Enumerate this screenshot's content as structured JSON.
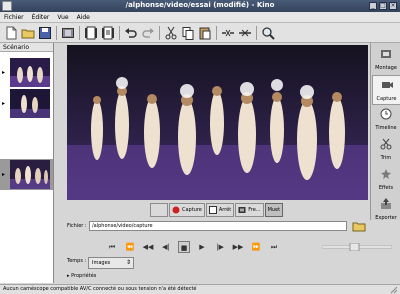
{
  "window": {
    "title": "/alphonse/video/essai (modifié) - Kino",
    "btn_min": "_",
    "btn_max": "□",
    "btn_close": "×"
  },
  "menu": [
    "Fichier",
    "Éditer",
    "Vue",
    "Aide"
  ],
  "scenario": {
    "header": "Scénario",
    "arrow": "▸"
  },
  "sidebar": [
    {
      "label": "Montage",
      "icon": "film-edit-icon"
    },
    {
      "label": "Capture",
      "icon": "camera-icon",
      "active": true
    },
    {
      "label": "Timeline",
      "icon": "clock-icon"
    },
    {
      "label": "Trim",
      "icon": "scissors-icon"
    },
    {
      "label": "Effets",
      "icon": "effects-icon"
    },
    {
      "label": "Exporter",
      "icon": "export-icon"
    }
  ],
  "capture": {
    "btn_capture": "Capture",
    "btn_stop": "Arrêt",
    "btn_frame": "Fre...",
    "btn_mute": "Muet"
  },
  "file": {
    "label": "Fichier :",
    "value": "/alphonse/video/capture"
  },
  "time": {
    "label": "Temps :",
    "unit": "Images"
  },
  "properties": {
    "label": "Propriétés",
    "arrow": "▸"
  },
  "status": {
    "message": "Aucun caméscope compatible AV/C connecté ou sous tension n'a été détecté"
  },
  "colors": {
    "titlebar": "#3d4c68",
    "stage_purple": "#5a3b8c",
    "record_red": "#d02020"
  }
}
